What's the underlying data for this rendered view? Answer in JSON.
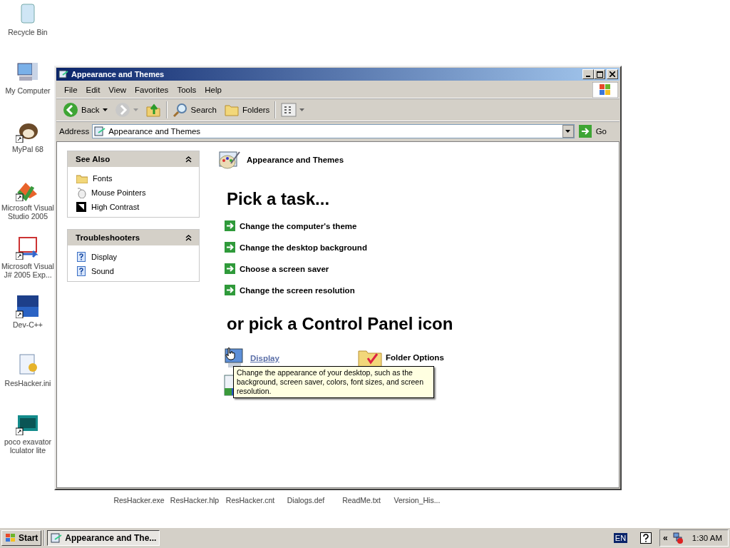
{
  "desktop_icons": [
    {
      "label": "Recycle Bin"
    },
    {
      "label": "My Computer"
    },
    {
      "label": "MyPal 68"
    },
    {
      "label": "Microsoft Visual Studio 2005"
    },
    {
      "label": "Microsoft Visual J# 2005 Exp..."
    },
    {
      "label": "Dev-C++"
    },
    {
      "label": "ResHacker.ini"
    },
    {
      "label": "poco exavator lculator lite"
    }
  ],
  "bottom_icons": [
    {
      "label": "ResHacker.exe"
    },
    {
      "label": "ResHacker.hlp"
    },
    {
      "label": "ResHacker.cnt"
    },
    {
      "label": "Dialogs.def"
    },
    {
      "label": "ReadMe.txt"
    },
    {
      "label": "Version_His..."
    }
  ],
  "window": {
    "title": "Appearance and Themes",
    "menu": [
      "File",
      "Edit",
      "View",
      "Favorites",
      "Tools",
      "Help"
    ],
    "toolbar": {
      "back": {
        "label": "Back"
      },
      "forward": {
        "disabled": true
      },
      "search": {
        "label": "Search"
      },
      "folders": {
        "label": "Folders"
      }
    },
    "address": {
      "label": "Address",
      "value": "Appearance and Themes",
      "go": "Go"
    },
    "panels": [
      {
        "title": "See Also",
        "expanded": true,
        "items": [
          {
            "label": "Fonts"
          },
          {
            "label": "Mouse Pointers"
          },
          {
            "label": "High Contrast"
          }
        ]
      },
      {
        "title": "Troubleshooters",
        "expanded": true,
        "items": [
          {
            "label": "Display"
          },
          {
            "label": "Sound"
          }
        ]
      }
    ],
    "category_title": "Appearance and Themes",
    "task_heading": "Pick a task...",
    "tasks": [
      "Change the computer's theme",
      "Change the desktop background",
      "Choose a screen saver",
      "Change the screen resolution"
    ],
    "icon_heading": "or pick a Control Panel icon",
    "icons": [
      {
        "label": "Display",
        "hovered": true
      },
      {
        "label": "Folder Options",
        "hovered": false
      }
    ],
    "tooltip": "Change the appearance of your desktop, such as the background, screen saver, colors, font sizes, and screen resolution."
  },
  "taskbar": {
    "start": "Start",
    "tasks": [
      {
        "label": "Appearance and The...",
        "selected": true
      }
    ],
    "language": "EN",
    "chevron": "«",
    "clock": "1:30 AM"
  }
}
